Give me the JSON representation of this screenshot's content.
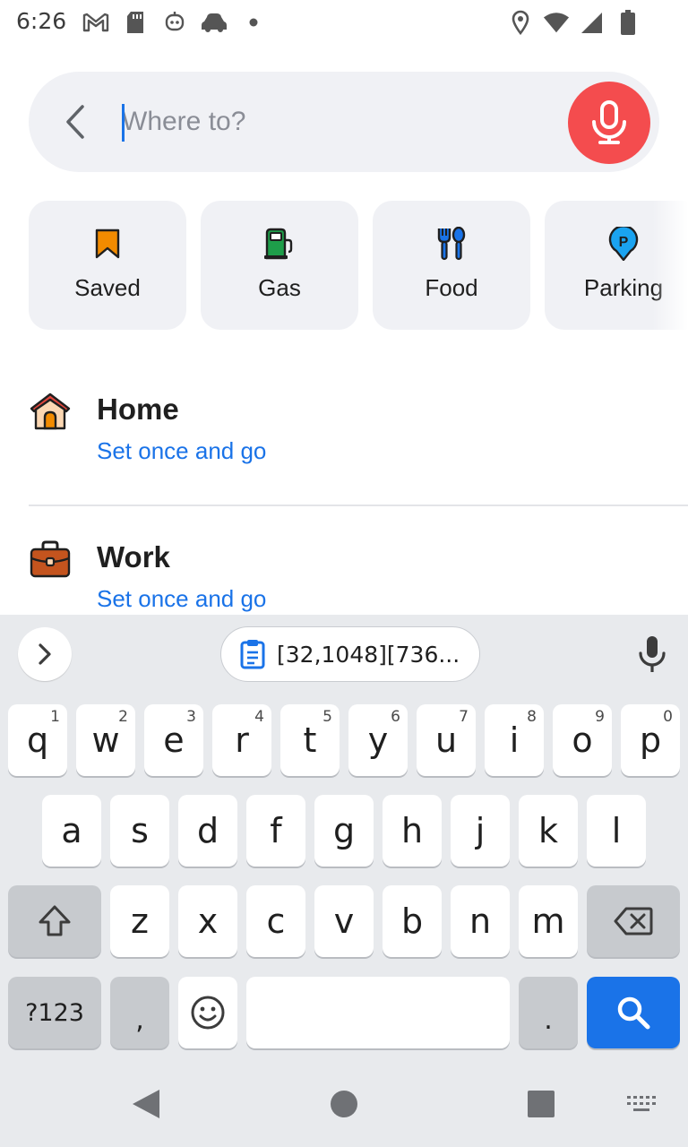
{
  "status_bar": {
    "time": "6:26",
    "left_icons": [
      "gmail-icon",
      "sd-card-icon",
      "assistant-icon",
      "car-icon",
      "dot-icon"
    ],
    "right_icons": [
      "location-icon",
      "wifi-icon",
      "signal-icon",
      "battery-icon"
    ]
  },
  "search": {
    "placeholder": "Where to?",
    "value": "",
    "back_icon": "back-icon",
    "mic_icon": "microphone-icon",
    "mic_color": "#f44c4e"
  },
  "categories": [
    {
      "label": "Saved",
      "icon": "bookmark-icon",
      "color": "#f28b00"
    },
    {
      "label": "Gas",
      "icon": "gas-pump-icon",
      "color": "#1e9e4a"
    },
    {
      "label": "Food",
      "icon": "utensils-icon",
      "color": "#1a73e8"
    },
    {
      "label": "Parking",
      "icon": "parking-icon",
      "color": "#1a73e8"
    }
  ],
  "places": [
    {
      "title": "Home",
      "subtitle": "Set once and go",
      "icon": "home-icon"
    },
    {
      "title": "Work",
      "subtitle": "Set once and go",
      "icon": "briefcase-icon"
    }
  ],
  "keyboard": {
    "clipboard_text": "[32,1048][736...",
    "row1": [
      {
        "key": "q",
        "hint": "1"
      },
      {
        "key": "w",
        "hint": "2"
      },
      {
        "key": "e",
        "hint": "3"
      },
      {
        "key": "r",
        "hint": "4"
      },
      {
        "key": "t",
        "hint": "5"
      },
      {
        "key": "y",
        "hint": "6"
      },
      {
        "key": "u",
        "hint": "7"
      },
      {
        "key": "i",
        "hint": "8"
      },
      {
        "key": "o",
        "hint": "9"
      },
      {
        "key": "p",
        "hint": "0"
      }
    ],
    "row2": [
      "a",
      "s",
      "d",
      "f",
      "g",
      "h",
      "j",
      "k",
      "l"
    ],
    "row3": [
      "z",
      "x",
      "c",
      "v",
      "b",
      "n",
      "m"
    ],
    "symbols_label": "?123",
    "comma_label": ",",
    "period_label": ".",
    "accent_color": "#1a73e8"
  }
}
